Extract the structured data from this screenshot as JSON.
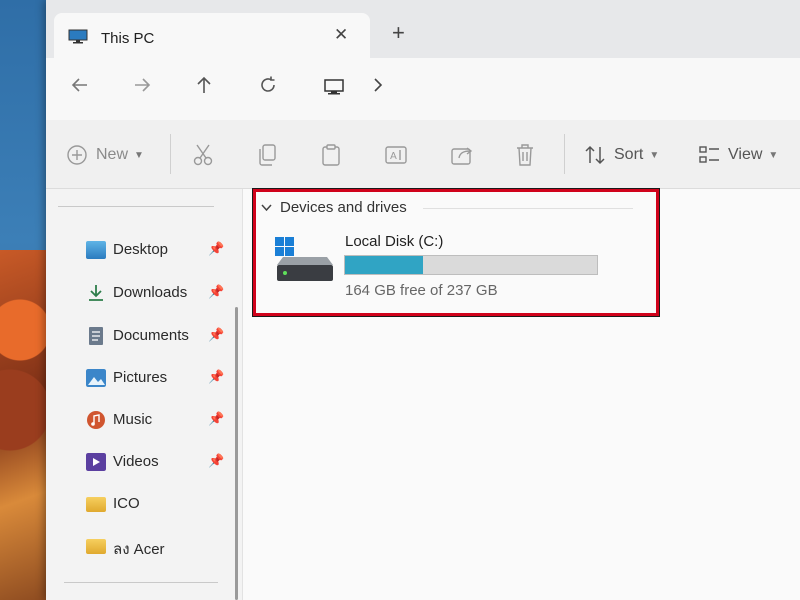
{
  "window": {
    "tab_title": "This PC",
    "tab_close": "✕",
    "new_tab": "+",
    "icons": {
      "tab": "monitor-icon",
      "back": "arrow-left-icon",
      "forward": "arrow-right-icon",
      "up": "arrow-up-icon",
      "refresh": "refresh-icon",
      "address": "monitor-icon",
      "breadcrumb": "chevron-right-icon"
    }
  },
  "toolbar": {
    "new_label": "New",
    "sort_label": "Sort",
    "view_label": "View",
    "icons": [
      "plus-circle-icon",
      "cut-icon",
      "copy-icon",
      "paste-icon",
      "rename-icon",
      "share-icon",
      "delete-icon",
      "sort-icon",
      "view-icon"
    ]
  },
  "sidebar": {
    "items": [
      {
        "label": "Desktop",
        "icon": "desktop-folder-icon",
        "pinned": true
      },
      {
        "label": "Downloads",
        "icon": "download-icon",
        "pinned": true
      },
      {
        "label": "Documents",
        "icon": "documents-icon",
        "pinned": true
      },
      {
        "label": "Pictures",
        "icon": "pictures-icon",
        "pinned": true
      },
      {
        "label": "Music",
        "icon": "music-icon",
        "pinned": true
      },
      {
        "label": "Videos",
        "icon": "videos-icon",
        "pinned": true
      },
      {
        "label": "ICO",
        "icon": "folder-icon",
        "pinned": false
      },
      {
        "label": "ลง Acer",
        "icon": "folder-icon",
        "pinned": false
      }
    ]
  },
  "content": {
    "group_header": "Devices and drives",
    "drive": {
      "name": "Local Disk (C:)",
      "space_text": "164 GB free of 237 GB",
      "used_fraction": 0.31
    }
  },
  "colors": {
    "drive_bar_fill": "#30a4c4",
    "highlight_border": "#d0021b"
  }
}
